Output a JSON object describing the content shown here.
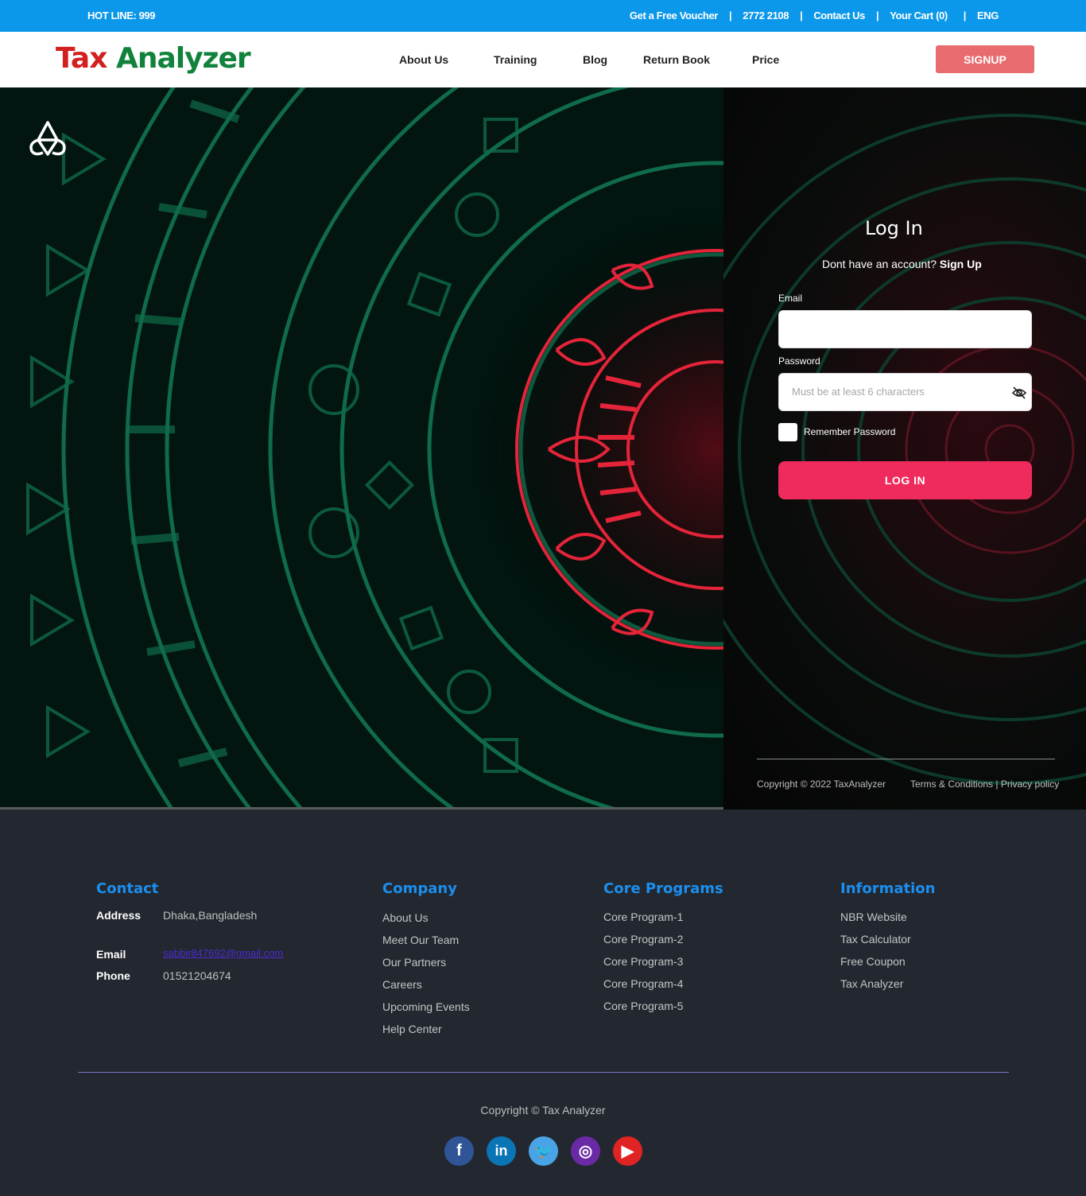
{
  "topbar": {
    "hotline": "HOT LINE: 999",
    "voucher": "Get a Free Voucher",
    "phone": "2772 2108",
    "contact": "Contact Us",
    "cart": "Your Cart (0)",
    "language": "ENG"
  },
  "nav": {
    "logo_part1": "Tax",
    "logo_part2": " Analyzer",
    "links": [
      "About Us",
      "Training",
      "Blog",
      "Return Book",
      "Price"
    ],
    "signup": "SIGNUP"
  },
  "login": {
    "title": "Log In",
    "prompt": "Dont have an account?",
    "signup_link": "Sign Up",
    "email_label": "Email",
    "email_value": "",
    "password_label": "Password",
    "password_placeholder": "Must be at least 6 characters",
    "remember": "Remember Password",
    "submit": "LOG IN",
    "copyright": "Copyright © 2022 TaxAnalyzer",
    "terms": "Terms & Conditions",
    "privacy": "Privacy policy"
  },
  "footer": {
    "contact": {
      "title": "Contact",
      "address_label": "Address",
      "address": "Dhaka,Bangladesh",
      "email_label": "Email",
      "email": "sabbir847692@gmail.com",
      "phone_label": "Phone",
      "phone": "01521204674"
    },
    "company": {
      "title": "Company",
      "links": [
        "About Us",
        "Meet Our Team",
        "Our Partners",
        "Careers",
        "Upcoming Events",
        "Help Center"
      ]
    },
    "programs": {
      "title": "Core Programs",
      "links": [
        "Core Program-1",
        "Core Program-2",
        "Core Program-3",
        "Core Program-4",
        "Core Program-5"
      ]
    },
    "information": {
      "title": "Information",
      "links": [
        "NBR Website",
        "Tax Calculator",
        "Free Coupon",
        "Tax Analyzer"
      ]
    },
    "copyright": "Copyright © Tax Analyzer",
    "social": [
      {
        "name": "facebook-icon",
        "glyph": "f",
        "color": "#2f5597"
      },
      {
        "name": "linkedin-icon",
        "glyph": "in",
        "color": "#0a75b5"
      },
      {
        "name": "twitter-icon",
        "glyph": "🐦",
        "color": "#4aa3e6"
      },
      {
        "name": "instagram-icon",
        "glyph": "◎",
        "color": "#6a2aa6"
      },
      {
        "name": "youtube-icon",
        "glyph": "▶",
        "color": "#e02424"
      }
    ]
  },
  "colors": {
    "topbar": "#0c98ea",
    "accent_red": "#ef2a5c",
    "signup_btn": "#e86b70",
    "footer_bg": "#232830",
    "footer_heading": "#1b8ff0",
    "logo_red": "#d21f1f",
    "logo_green": "#11823b"
  }
}
